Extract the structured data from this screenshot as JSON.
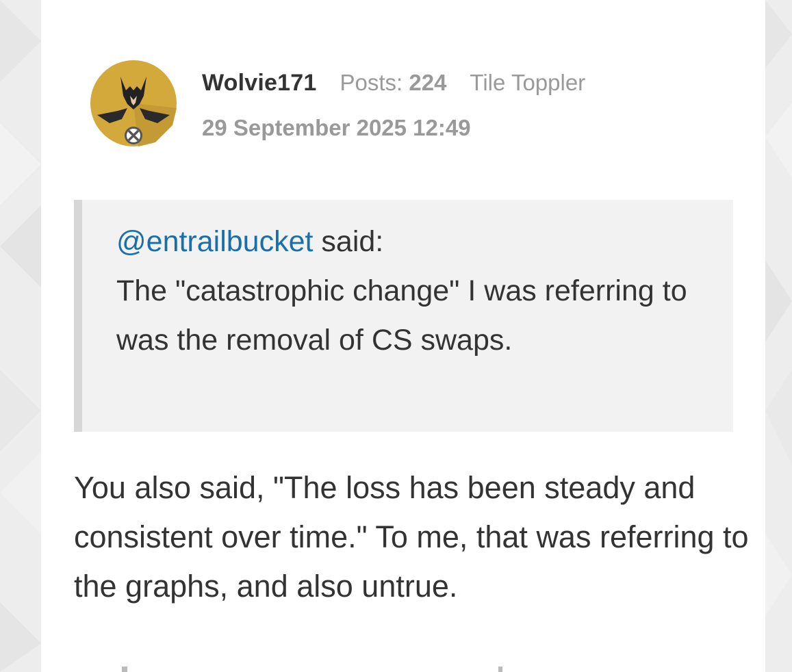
{
  "post": {
    "author": {
      "username": "Wolvie171",
      "posts_label": "Posts:",
      "posts_count": "224",
      "rank": "Tile Toppler",
      "avatar_icon": "wolverine-avatar-icon"
    },
    "timestamp": "29 September 2025 12:49",
    "quote": {
      "mention": "@entrailbucket",
      "said_label": "said:",
      "text": "The \"catastrophic change\" I was referring to was the removal of CS swaps."
    },
    "body": "You also said, \"The loss has been steady and consistent over time.\" To me, that was referring to the graphs, and also untrue."
  },
  "colors": {
    "page_background": "#ededed",
    "card_background": "#ffffff",
    "quote_background": "#f2f2f2",
    "quote_border": "#d7d7d7",
    "mention_link": "#1a6fa8",
    "meta_text": "#999999",
    "body_text": "#333333",
    "avatar_gold": "#d4a93c"
  }
}
